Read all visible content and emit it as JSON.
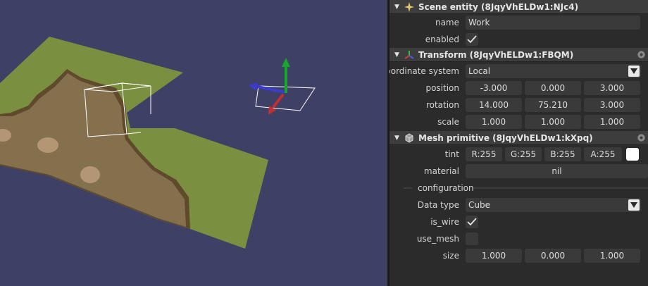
{
  "scene_entity": {
    "title": "Scene entity (8JqyVhELDw1:NJc4)",
    "name_label": "name",
    "name_value": "Work",
    "enabled_label": "enabled"
  },
  "transform": {
    "title": "Transform (8JqyVhELDw1:FBQM)",
    "coord_label": "Coordinate system",
    "coord_value": "Local",
    "position_label": "position",
    "position": [
      "-3.000",
      "0.000",
      "3.000"
    ],
    "rotation_label": "rotation",
    "rotation": [
      "14.000",
      "75.210",
      "3.000"
    ],
    "scale_label": "scale",
    "scale": [
      "1.000",
      "1.000",
      "1.000"
    ]
  },
  "mesh": {
    "title": "Mesh primitive (8JqyVhELDw1:kXpq)",
    "tint_label": "tint",
    "tint": [
      "R:255",
      "G:255",
      "B:255",
      "A:255"
    ],
    "material_label": "material",
    "material_value": "nil",
    "configuration_label": "configuration",
    "datatype_label": "Data type",
    "datatype_value": "Cube",
    "iswire_label": "is_wire",
    "usemesh_label": "use_mesh",
    "size_label": "size",
    "size": [
      "1.000",
      "0.000",
      "1.000"
    ]
  },
  "colors": {
    "viewport_bg": "#3f4066",
    "grass": "#7a9040",
    "dirt": "#84704d",
    "tint_swatch": "#ffffff"
  }
}
